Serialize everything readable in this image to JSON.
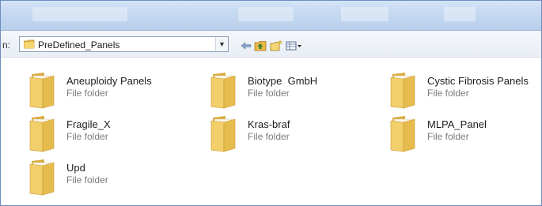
{
  "address_bar": {
    "label": "n:",
    "path": "PreDefined_Panels"
  },
  "toolbar": {
    "icons": [
      "back-arrow-icon",
      "up-folder-icon",
      "new-folder-icon",
      "views-icon"
    ]
  },
  "folders": [
    {
      "name": "Aneuploidy Panels",
      "type": "File folder"
    },
    {
      "name": "Biotype  GmbH",
      "type": "File folder"
    },
    {
      "name": "Cystic Fibrosis Panels",
      "type": "File folder"
    },
    {
      "name": "Fragile_X",
      "type": "File folder"
    },
    {
      "name": "Kras-braf",
      "type": "File folder"
    },
    {
      "name": "MLPA_Panel",
      "type": "File folder"
    },
    {
      "name": "Upd",
      "type": "File folder"
    }
  ],
  "colors": {
    "folder_body": "#f2cf6b",
    "folder_shade": "#d9a93a",
    "title_bar": "#c6d9f1"
  }
}
